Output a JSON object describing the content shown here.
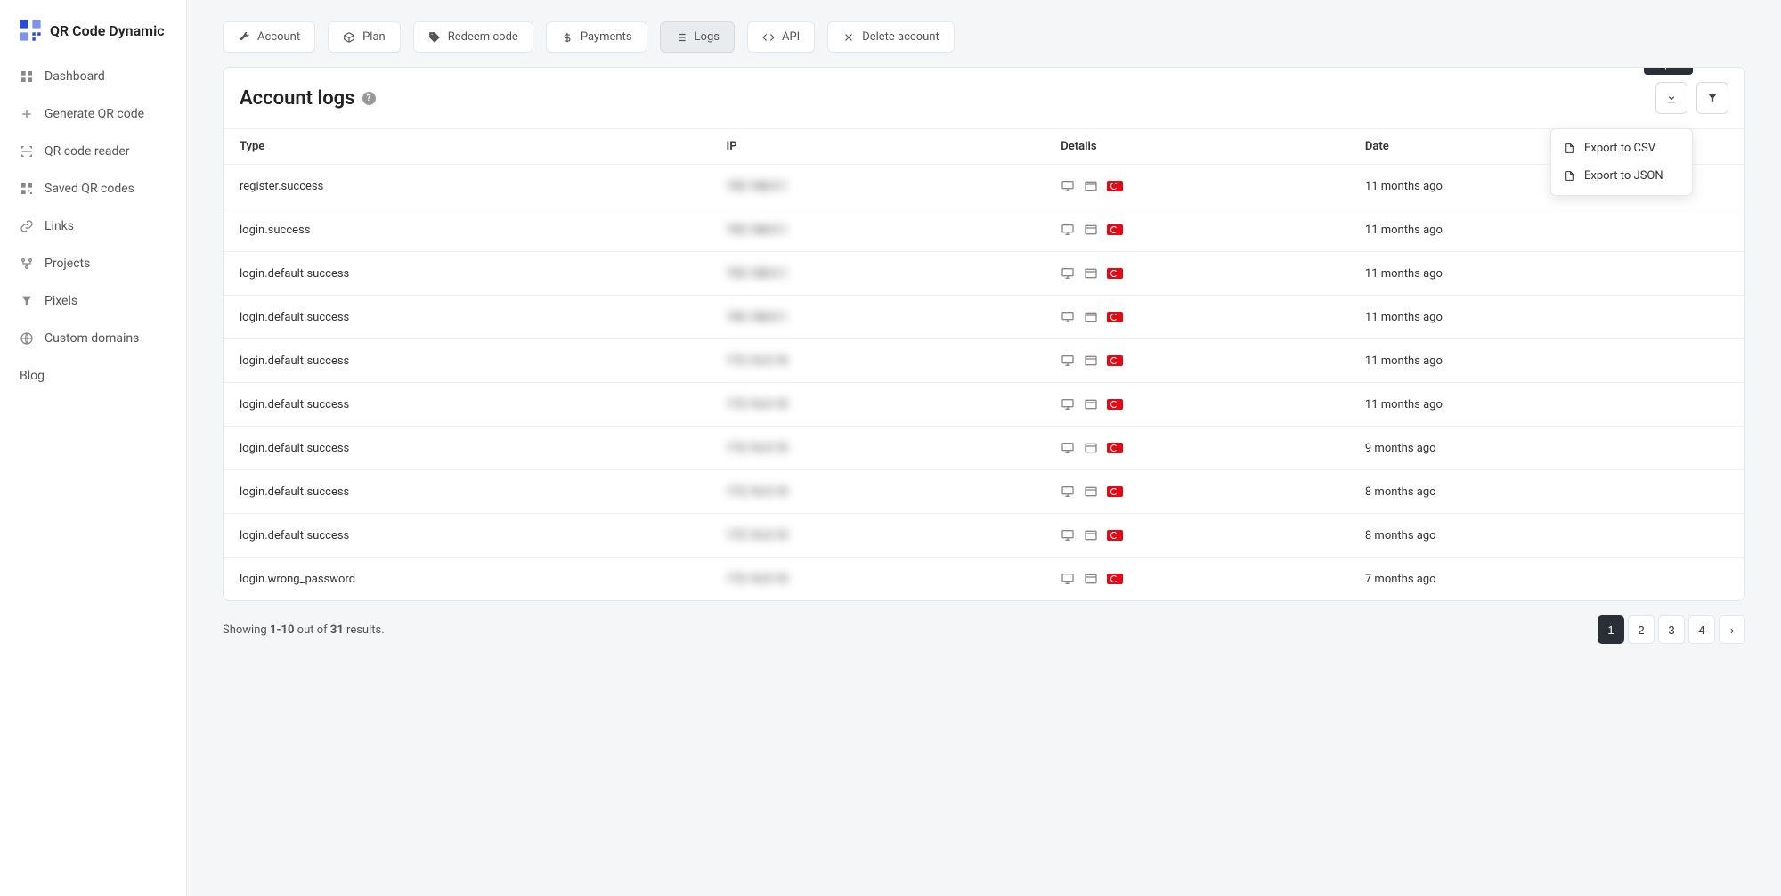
{
  "brand": "QR Code Dynamic",
  "sidebar": {
    "items": [
      {
        "label": "Dashboard"
      },
      {
        "label": "Generate QR code"
      },
      {
        "label": "QR code reader"
      },
      {
        "label": "Saved QR codes"
      },
      {
        "label": "Links"
      },
      {
        "label": "Projects"
      },
      {
        "label": "Pixels"
      },
      {
        "label": "Custom domains"
      },
      {
        "label": "Blog"
      }
    ]
  },
  "tabs": [
    {
      "label": "Account"
    },
    {
      "label": "Plan"
    },
    {
      "label": "Redeem code"
    },
    {
      "label": "Payments"
    },
    {
      "label": "Logs"
    },
    {
      "label": "API"
    },
    {
      "label": "Delete account"
    }
  ],
  "card": {
    "title": "Account logs",
    "tooltip": "Export",
    "dropdown": [
      {
        "label": "Export to CSV"
      },
      {
        "label": "Export to JSON"
      }
    ]
  },
  "table": {
    "cols": [
      "Type",
      "IP",
      "Details",
      "Date"
    ],
    "rows": [
      {
        "type": "register.success",
        "ip": "192.168.0.1",
        "date": "11 months ago"
      },
      {
        "type": "login.success",
        "ip": "192.168.0.1",
        "date": "11 months ago"
      },
      {
        "type": "login.default.success",
        "ip": "192.168.0.1",
        "date": "11 months ago"
      },
      {
        "type": "login.default.success",
        "ip": "192.168.0.1",
        "date": "11 months ago"
      },
      {
        "type": "login.default.success",
        "ip": "172.16.0.10",
        "date": "11 months ago"
      },
      {
        "type": "login.default.success",
        "ip": "172.16.0.10",
        "date": "11 months ago"
      },
      {
        "type": "login.default.success",
        "ip": "172.16.0.10",
        "date": "9 months ago"
      },
      {
        "type": "login.default.success",
        "ip": "172.16.0.10",
        "date": "8 months ago"
      },
      {
        "type": "login.default.success",
        "ip": "172.16.0.10",
        "date": "8 months ago"
      },
      {
        "type": "login.wrong_password",
        "ip": "172.16.0.10",
        "date": "7 months ago"
      }
    ]
  },
  "pagination": {
    "showing_prefix": "Showing ",
    "range": "1-10",
    "out_of": " out of ",
    "total": "31",
    "results": " results.",
    "pages": [
      "1",
      "2",
      "3",
      "4",
      "›"
    ]
  }
}
